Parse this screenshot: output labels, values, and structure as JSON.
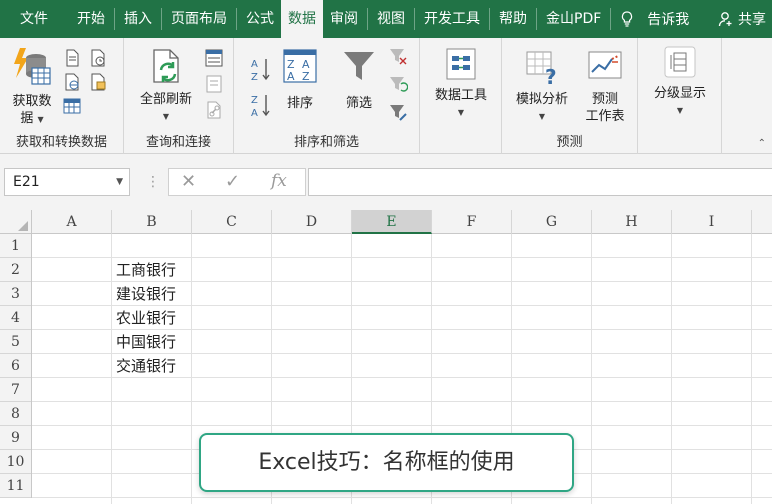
{
  "colors": {
    "brand": "#217346",
    "caption_border": "#2fa684"
  },
  "tabs": [
    "文件",
    "开始",
    "插入",
    "页面布局",
    "公式",
    "数据",
    "审阅",
    "视图",
    "开发工具",
    "帮助",
    "金山PDF"
  ],
  "active_tab": "数据",
  "tell_me": "告诉我",
  "share": "共享",
  "ribbon": {
    "get_data": {
      "line1": "获取数",
      "line2": "据",
      "group": "获取和转换数据"
    },
    "refresh_all": {
      "label": "全部刷新",
      "group": "查询和连接"
    },
    "sort": {
      "label": "排序",
      "group": "排序和筛选"
    },
    "filter": {
      "label": "筛选"
    },
    "data_tools": {
      "label": "数据工具"
    },
    "what_if": {
      "label": "模拟分析"
    },
    "forecast_sheet": {
      "line1": "预测",
      "line2": "工作表",
      "group": "预测"
    },
    "outline": {
      "label": "分级显示"
    }
  },
  "name_box": "E21",
  "fx_label": "fx",
  "columns": [
    "A",
    "B",
    "C",
    "D",
    "E",
    "F",
    "G",
    "H",
    "I"
  ],
  "selected_column": "E",
  "rows": [
    "1",
    "2",
    "3",
    "4",
    "5",
    "6",
    "7",
    "8",
    "9",
    "10",
    "11"
  ],
  "cells": {
    "B2": "工商银行",
    "B3": "建设银行",
    "B4": "农业银行",
    "B5": "中国银行",
    "B6": "交通银行"
  },
  "caption": "Excel技巧：名称框的使用"
}
